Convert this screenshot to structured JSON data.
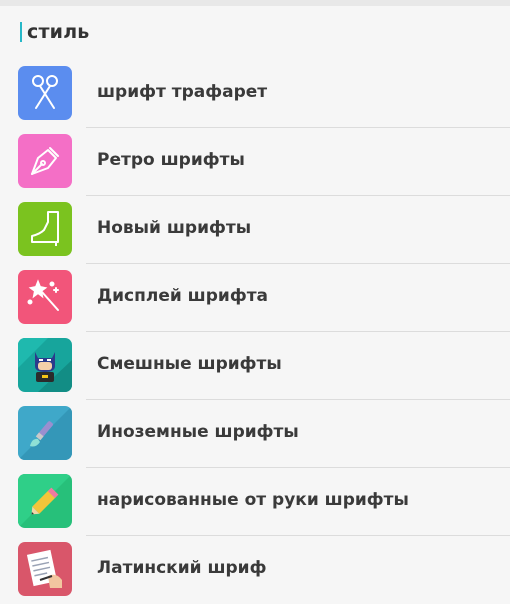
{
  "section": {
    "title": "стиль"
  },
  "items": [
    {
      "label": "шрифт трафарет",
      "color": "#5b8def",
      "icon": "scissors-icon"
    },
    {
      "label": "Ретро шрифты",
      "color": "#f46fc6",
      "icon": "pen-nib-icon"
    },
    {
      "label": "Новый шрифты",
      "color": "#7bc31f",
      "icon": "boot-icon"
    },
    {
      "label": "Дисплей шрифта",
      "color": "#f2557a",
      "icon": "magic-wand-icon"
    },
    {
      "label": "Смешные шрифты",
      "color": "#17a59c",
      "icon": "batman-icon"
    },
    {
      "label": "Иноземные шрифты",
      "color": "#3fa8c9",
      "icon": "paintbrush-icon"
    },
    {
      "label": "нарисованные от руки шрифты",
      "color": "#27c07a",
      "icon": "pencil-icon"
    },
    {
      "label": "Латинский шриф",
      "color": "#d9566a",
      "icon": "writing-hand-icon"
    }
  ]
}
